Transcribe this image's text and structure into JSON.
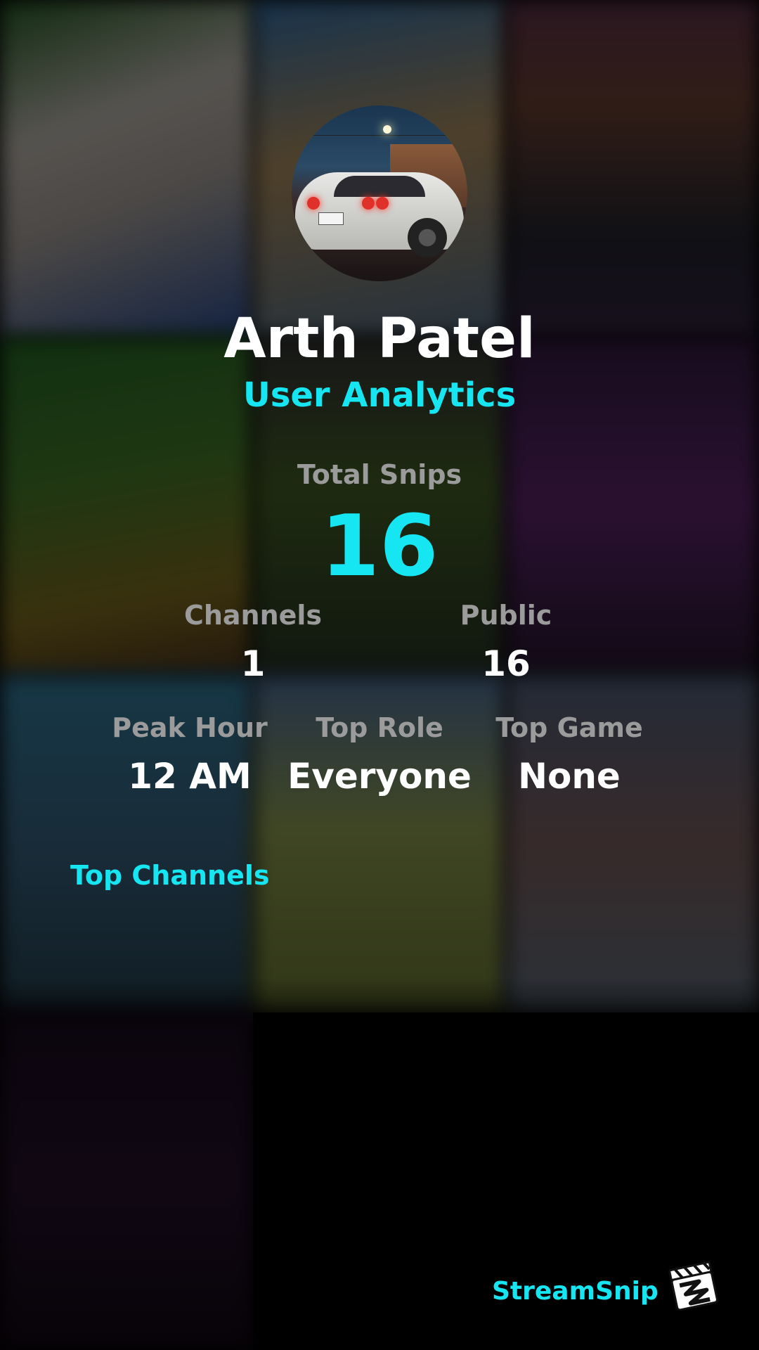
{
  "profile": {
    "name": "Arth Patel",
    "subtitle": "User Analytics"
  },
  "stats": {
    "total_snips": {
      "label": "Total Snips",
      "value": "16"
    },
    "channels": {
      "label": "Channels",
      "value": "1"
    },
    "public": {
      "label": "Public",
      "value": "16"
    },
    "peak_hour": {
      "label": "Peak Hour",
      "value": "12 AM"
    },
    "top_role": {
      "label": "Top Role",
      "value": "Everyone"
    },
    "top_game": {
      "label": "Top Game",
      "value": "None"
    }
  },
  "sections": {
    "top_channels": "Top Channels"
  },
  "brand": {
    "name": "StreamSnip",
    "icon": "clapperboard-icon"
  },
  "colors": {
    "accent": "#16e6f2",
    "label_gray": "#9b9b9b",
    "text": "#ffffff"
  }
}
